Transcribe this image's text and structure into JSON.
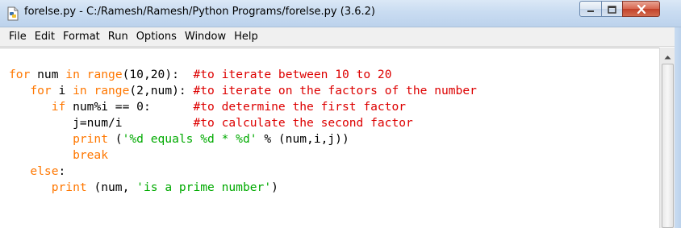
{
  "window": {
    "title": "forelse.py - C:/Ramesh/Ramesh/Python Programs/forelse.py (3.6.2)",
    "app_icon": "python-file-icon",
    "controls": [
      "minimize-icon",
      "maximize-icon",
      "close-icon"
    ]
  },
  "menu": {
    "items": [
      "File",
      "Edit",
      "Format",
      "Run",
      "Options",
      "Window",
      "Help"
    ]
  },
  "editor": {
    "syntax_colors": {
      "keyword": "#ff7700",
      "comment": "#dd0000",
      "string": "#00aa00",
      "default": "#000000"
    },
    "lines": [
      [
        {
          "t": "kw",
          "v": "for"
        },
        {
          "t": "",
          "v": " num "
        },
        {
          "t": "kw",
          "v": "in"
        },
        {
          "t": "",
          "v": " "
        },
        {
          "t": "kw",
          "v": "range"
        },
        {
          "t": "",
          "v": "(10,20):  "
        },
        {
          "t": "cmt",
          "v": "#to iterate between 10 to 20"
        }
      ],
      [
        {
          "t": "",
          "v": "   "
        },
        {
          "t": "kw",
          "v": "for"
        },
        {
          "t": "",
          "v": " i "
        },
        {
          "t": "kw",
          "v": "in"
        },
        {
          "t": "",
          "v": " "
        },
        {
          "t": "kw",
          "v": "range"
        },
        {
          "t": "",
          "v": "(2,num): "
        },
        {
          "t": "cmt",
          "v": "#to iterate on the factors of the number"
        }
      ],
      [
        {
          "t": "",
          "v": "      "
        },
        {
          "t": "kw",
          "v": "if"
        },
        {
          "t": "",
          "v": " num%i == 0:      "
        },
        {
          "t": "cmt",
          "v": "#to determine the first factor"
        }
      ],
      [
        {
          "t": "",
          "v": "         j=num/i          "
        },
        {
          "t": "cmt",
          "v": "#to calculate the second factor"
        }
      ],
      [
        {
          "t": "",
          "v": "         "
        },
        {
          "t": "kw",
          "v": "print"
        },
        {
          "t": "",
          "v": " ("
        },
        {
          "t": "str",
          "v": "'%d equals %d * %d'"
        },
        {
          "t": "",
          "v": " % (num,i,j))"
        }
      ],
      [
        {
          "t": "",
          "v": "         "
        },
        {
          "t": "kw",
          "v": "break"
        }
      ],
      [
        {
          "t": "",
          "v": "   "
        },
        {
          "t": "kw",
          "v": "else"
        },
        {
          "t": "",
          "v": ":"
        }
      ],
      [
        {
          "t": "",
          "v": "      "
        },
        {
          "t": "kw",
          "v": "print"
        },
        {
          "t": "",
          "v": " (num, "
        },
        {
          "t": "str",
          "v": "'is a prime number'"
        },
        {
          "t": "",
          "v": ")"
        }
      ]
    ]
  }
}
